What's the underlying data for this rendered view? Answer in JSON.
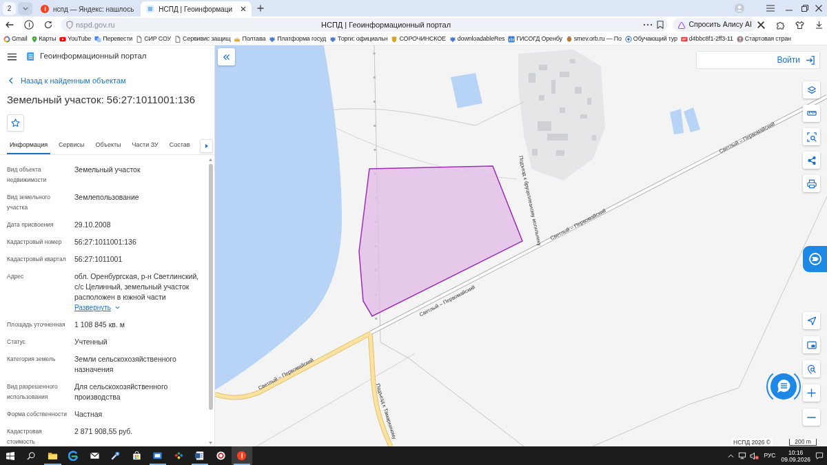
{
  "browser": {
    "tab_count": "2",
    "tabs": [
      {
        "title": "нспд — Яндекс: нашлось",
        "selected": false
      },
      {
        "title": "НСПД | Геоинформаци",
        "selected": true
      }
    ],
    "address": "nspd.gov.ru",
    "page_title": "НСПД | Геоинформационный портал",
    "assistant_button": "Спросить Алису AI",
    "bookmarks": [
      "Gmail",
      "Карты",
      "YouTube",
      "Перевести",
      "СИР СОУ",
      "Сервивис защищ",
      "Полтава",
      "Платформа госуд",
      "Торги: официальн",
      "СОРОЧИНСКОЕ",
      "downloadableRes",
      "ГИСОГД Оренбу",
      "smev.orb.ru — По",
      "Обучающий тур",
      "d4bbc8f1-2ff3-11",
      "Стартовая стран"
    ]
  },
  "portal": {
    "title": "Геоинформационный портал",
    "back_link": "Назад к найденным объектам",
    "object_title": "Земельный участок: 56:27:1011001:136",
    "tabs": [
      {
        "label": "Информация",
        "selected": true
      },
      {
        "label": "Сервисы",
        "selected": false
      },
      {
        "label": "Объекты",
        "selected": false
      },
      {
        "label": "Части ЗУ",
        "selected": false
      },
      {
        "label": "Состав",
        "selected": false
      }
    ],
    "fields": [
      {
        "label": "Вид объекта недвижимости",
        "value": "Земельный участок"
      },
      {
        "label": "Вид земельного участка",
        "value": "Землепользование"
      },
      {
        "label": "Дата присвоения",
        "value": "29.10.2008"
      },
      {
        "label": "Кадастровый номер",
        "value": "56:27:1011001:136"
      },
      {
        "label": "Кадастровый квартал",
        "value": "56:27:1011001"
      },
      {
        "label": "Адрес",
        "value": "обл. Оренбургская, р-н Светлинский, с/с Целинный, земельный участок расположен в южной части",
        "link": "Развернуть"
      },
      {
        "label": "Площадь уточненная",
        "value": "1 108 845 кв. м"
      },
      {
        "label": "Статус",
        "value": "Учтенный"
      },
      {
        "label": "Категория земель",
        "value": "Земли сельскохозяйственного назначения"
      },
      {
        "label": "Вид разрешенного использования",
        "value": "Для сельскохозяйственного производства"
      },
      {
        "label": "Форма собственности",
        "value": "Частная"
      },
      {
        "label": "Кадастровая стоимость",
        "value": "2 871 908,55 руб."
      }
    ]
  },
  "map": {
    "login_button": "Войти",
    "road_labels": [
      "Светлый – Первомайский",
      "Светлый – Первомайский",
      "Светлый – Первомайский",
      "Светлый – Первомайский",
      "Подъезд к Тамаркиному",
      "Подъезд к бруцеллезному могильнику"
    ],
    "copyright": "НСПД 2026 ©",
    "scale": "200 m"
  },
  "taskbar": {
    "apps": [
      {
        "kind": "folder",
        "running": true,
        "selected": false
      },
      {
        "kind": "browser",
        "running": false,
        "selected": false
      },
      {
        "kind": "mail",
        "running": false,
        "selected": false
      },
      {
        "kind": "tool",
        "running": false,
        "selected": false
      },
      {
        "kind": "store",
        "running": false,
        "selected": false
      },
      {
        "kind": "window",
        "running": true,
        "selected": false
      },
      {
        "kind": "tiles",
        "running": false,
        "selected": false
      },
      {
        "kind": "document",
        "running": true,
        "selected": false
      },
      {
        "kind": "ring",
        "running": false,
        "selected": false
      },
      {
        "kind": "disc",
        "running": true,
        "selected": true
      }
    ],
    "language": "РУС",
    "time": "10:16",
    "date": "09.09.2026"
  }
}
